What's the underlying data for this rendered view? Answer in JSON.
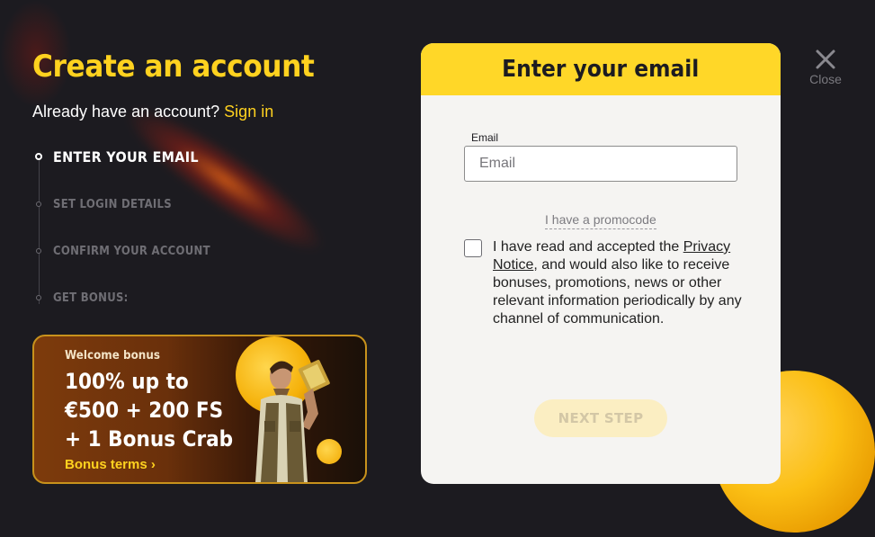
{
  "header": {
    "title": "Create an account",
    "signin_prompt": "Already have an account?",
    "signin_link": "Sign in"
  },
  "steps": [
    {
      "label": "ENTER YOUR EMAIL",
      "active": true
    },
    {
      "label": "SET LOGIN DETAILS",
      "active": false
    },
    {
      "label": "CONFIRM YOUR ACCOUNT",
      "active": false
    },
    {
      "label": "GET BONUS:",
      "active": false
    }
  ],
  "bonus": {
    "heading": "Welcome bonus",
    "offer_line1": "100% up to",
    "offer_line2": "€500 + 200 FS",
    "offer_line3": "+ 1 Bonus Crab",
    "terms_link": "Bonus terms ›"
  },
  "modal": {
    "title": "Enter your email",
    "email_label": "Email",
    "email_placeholder": "Email",
    "email_value": "",
    "promocode_link": "I have a promocode",
    "consent_before": "I have read and accepted the ",
    "consent_link": "Privacy Notice",
    "consent_after": ", and would also like to receive bonuses, promotions, news or other relevant information periodically by any channel of communication.",
    "consent_checked": false,
    "next_button": "NEXT STEP"
  },
  "close": {
    "icon": "close-icon",
    "label": "Close"
  },
  "colors": {
    "background": "#1c1b20",
    "accent": "#ffd21f",
    "modal_header": "#ffd728"
  }
}
